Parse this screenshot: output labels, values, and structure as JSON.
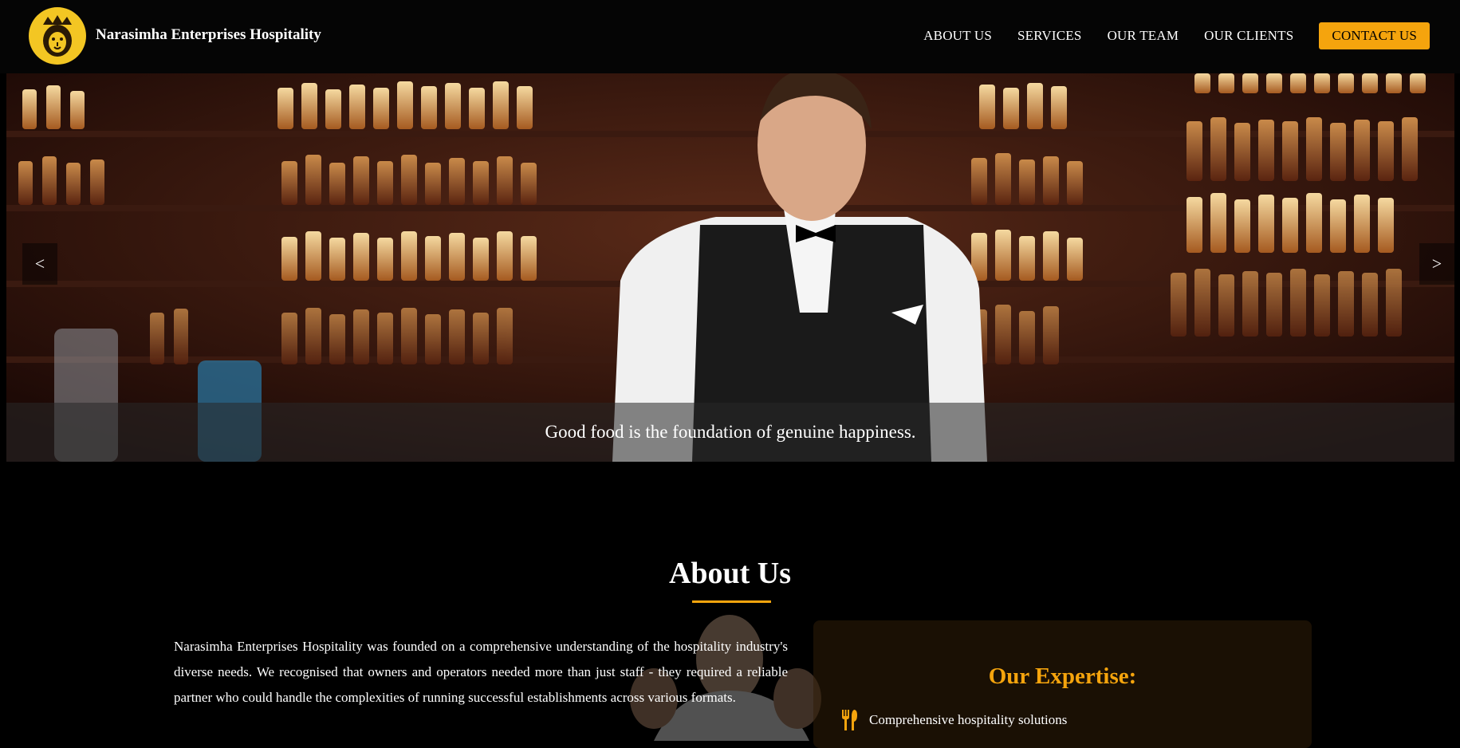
{
  "header": {
    "brand": "Narasimha Enterprises Hospitality",
    "logo_icon": "lion-icon",
    "nav": {
      "about": "ABOUT US",
      "services": "SERVICES",
      "team": "OUR TEAM",
      "clients": "OUR CLIENTS",
      "contact": "CONTACT US"
    }
  },
  "hero": {
    "caption": "Good food is the foundation of genuine happiness.",
    "prev_label": "<",
    "next_label": ">"
  },
  "about": {
    "title": "About Us",
    "paragraph": "Narasimha Enterprises Hospitality was founded on a comprehensive understanding of the hospitality industry's diverse needs. We recognised that owners and operators needed more than just staff - they required a reliable partner who could handle the complexities of running successful establishments across various formats.",
    "expertise": {
      "title": "Our Expertise:",
      "items": [
        {
          "icon": "utensils-icon",
          "label": "Comprehensive hospitality solutions"
        }
      ]
    }
  },
  "colors": {
    "accent": "#f5a40d",
    "background": "#000000",
    "logo": "#f3c623"
  }
}
